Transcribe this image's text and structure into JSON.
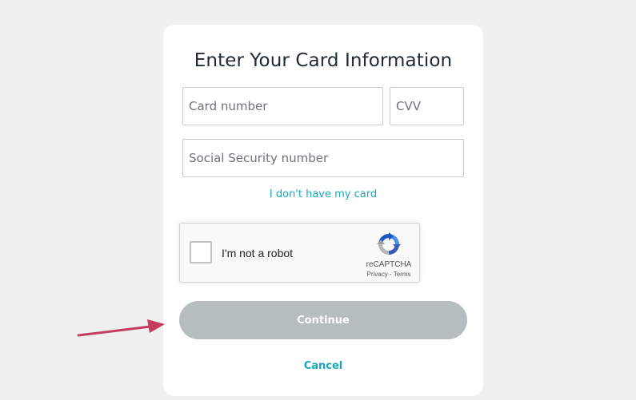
{
  "form": {
    "title": "Enter Your Card Information",
    "card_number_placeholder": "Card number",
    "cvv_placeholder": "CVV",
    "ssn_placeholder": "Social Security number",
    "no_card_link": "I don't have my card",
    "continue_label": "Continue",
    "cancel_label": "Cancel"
  },
  "recaptcha": {
    "label": "I'm not a robot",
    "brand": "reCAPTCHA",
    "privacy": "Privacy",
    "separator": " - ",
    "terms": "Terms",
    "checked": false
  },
  "colors": {
    "background": "#eff0ef",
    "link": "#1aa8b8",
    "button_disabled": "#b6bdbe",
    "annotation_arrow": "#c43c62"
  },
  "icons": [
    "recaptcha-logo-icon",
    "annotation-arrow-icon"
  ]
}
